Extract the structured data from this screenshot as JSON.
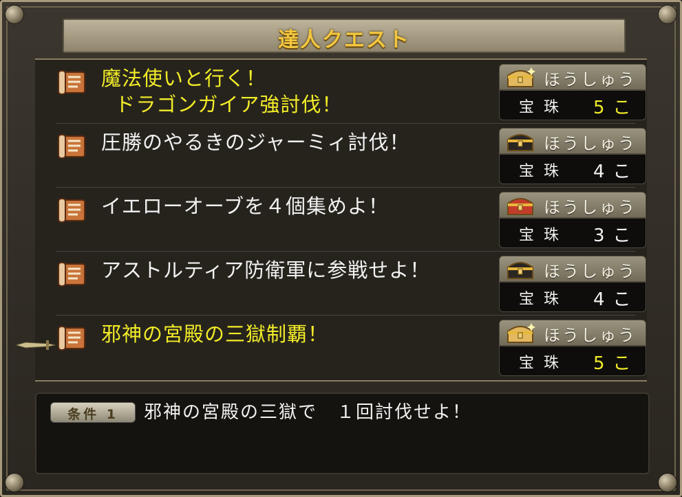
{
  "window": {
    "title": "達人クエスト"
  },
  "colors": {
    "highlight": "#f2ec28",
    "normal_text": "#f2f2f2"
  },
  "reward_label": "ほうしゅう",
  "quests": [
    {
      "title": "魔法使いと行く！\n  ドラゴンガイア強討伐！",
      "highlighted": true,
      "chest": "gold-sparkle-chest",
      "item": "宝珠",
      "count": "5こ",
      "count_highlighted": true
    },
    {
      "title": "圧勝のやるきのジャーミィ討伐！",
      "highlighted": false,
      "chest": "black-chest",
      "item": "宝珠",
      "count": "4こ",
      "count_highlighted": false
    },
    {
      "title": "イエローオーブを４個集めよ！",
      "highlighted": false,
      "chest": "red-chest",
      "item": "宝珠",
      "count": "3こ",
      "count_highlighted": false
    },
    {
      "title": "アストルティア防衛軍に参戦せよ！",
      "highlighted": false,
      "chest": "black-chest",
      "item": "宝珠",
      "count": "4こ",
      "count_highlighted": false
    },
    {
      "title": "邪神の宮殿の三獄制覇！",
      "highlighted": true,
      "chest": "gold-sparkle-chest",
      "item": "宝珠",
      "count": "5こ",
      "count_highlighted": true
    }
  ],
  "selected_index": 4,
  "condition": {
    "badge": "条件 1",
    "text": "邪神の宮殿の三獄で　１回討伐せよ！"
  }
}
